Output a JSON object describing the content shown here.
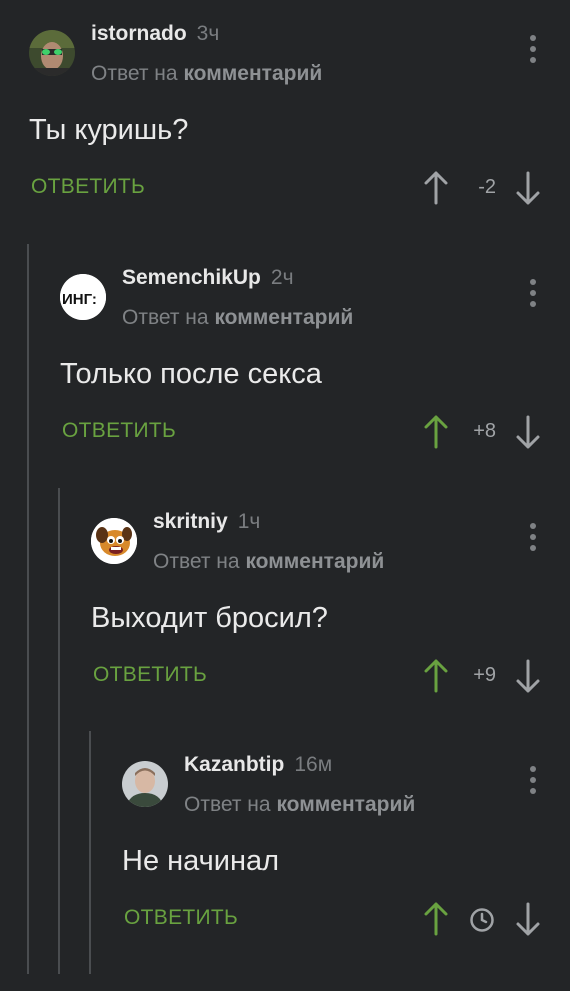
{
  "comments": [
    {
      "author": "istornado",
      "time": "3ч",
      "reply_prefix": "Ответ на",
      "reply_target": "комментарий",
      "text": "Ты куришь?",
      "reply_label": "ОТВЕТИТЬ",
      "score": "-2",
      "voted_up": false
    },
    {
      "author": "SemenchikUp",
      "time": "2ч",
      "reply_prefix": "Ответ на",
      "reply_target": "комментарий",
      "text": "Только после секса",
      "reply_label": "ОТВЕТИТЬ",
      "score": "+8",
      "voted_up": true,
      "avatar_text": "ИНГ:"
    },
    {
      "author": "skritniy",
      "time": "1ч",
      "reply_prefix": "Ответ на",
      "reply_target": "комментарий",
      "text": "Выходит бросил?",
      "reply_label": "ОТВЕТИТЬ",
      "score": "+9",
      "voted_up": true
    },
    {
      "author": "Kazanbtip",
      "time": "16м",
      "reply_prefix": "Ответ на",
      "reply_target": "комментарий",
      "text": "Не начинал",
      "reply_label": "ОТВЕТИТЬ",
      "score": "",
      "score_icon": "clock-icon",
      "voted_up": true
    }
  ],
  "colors": {
    "background": "#232527",
    "accent_green": "#69a240",
    "muted": "#7f8285",
    "thread_line": "#4a4d50"
  }
}
